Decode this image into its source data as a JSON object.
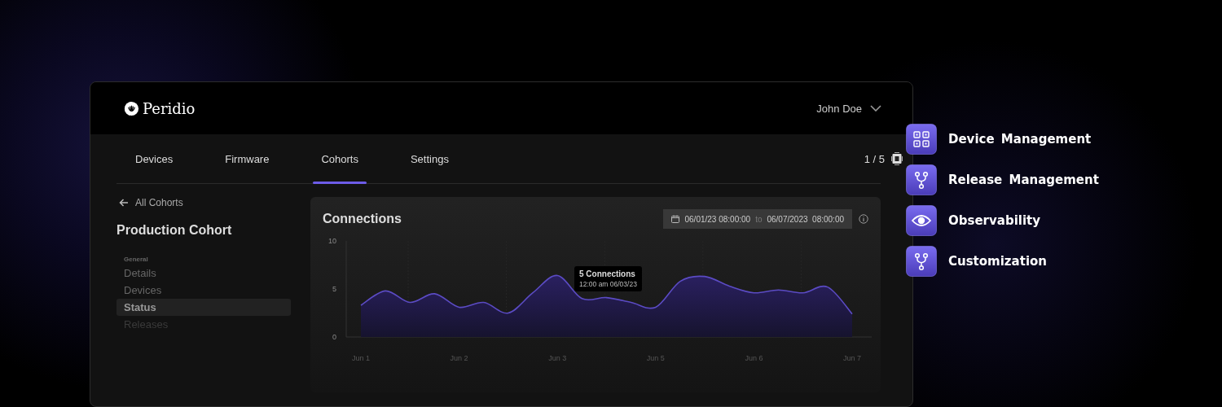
{
  "app": {
    "brand": {
      "name": "Peridio"
    },
    "user": {
      "name": "John Doe"
    },
    "tabs": [
      {
        "label": "Devices",
        "selected": false
      },
      {
        "label": "Firmware",
        "selected": false
      },
      {
        "label": "Cohorts",
        "selected": true
      },
      {
        "label": "Settings",
        "selected": false
      }
    ],
    "pager": {
      "text": "1 / 5"
    },
    "back_link": {
      "label": "All Cohorts"
    },
    "page_title": "Production Cohort",
    "sidebar": {
      "section": "General",
      "items": [
        {
          "label": "Details",
          "selected": false,
          "disabled": false
        },
        {
          "label": "Devices",
          "selected": false,
          "disabled": false
        },
        {
          "label": "Status",
          "selected": true,
          "disabled": false
        },
        {
          "label": "Releases",
          "selected": false,
          "disabled": true
        }
      ]
    },
    "chart_card": {
      "title": "Connections",
      "date_range": {
        "start": "06/01/23 08:00:00",
        "separator": "to",
        "end": "06/07/2023  08:00:00"
      },
      "tooltip": {
        "title": "5 Connections",
        "subtitle": "12:00 am 06/03/23"
      },
      "chart_data": {
        "type": "area",
        "categories": [
          "Jun 1",
          null,
          null,
          null,
          "Jun 2",
          null,
          null,
          null,
          "Jun 3",
          null,
          null,
          null,
          "Jun 5",
          null,
          null,
          null,
          "Jun 6",
          null,
          null,
          null,
          "Jun 7"
        ],
        "series": [
          {
            "color": "#5b4bc4",
            "values": [
              3.3,
              4.8,
              3.6,
              4.5,
              3.1,
              3.6,
              2.5,
              4.6,
              6.4,
              4.0,
              4.1,
              3.6,
              3.1,
              5.8,
              6.3,
              5.3,
              4.6,
              4.9,
              4.6,
              5.2,
              2.4
            ]
          }
        ],
        "ylim": [
          0,
          10
        ],
        "grid": true,
        "yticks": [
          0,
          5,
          10
        ]
      }
    }
  },
  "features": [
    {
      "label": "Device Management",
      "kind": "grid"
    },
    {
      "label": "Release Management",
      "kind": "branch"
    },
    {
      "label": "Observability",
      "kind": "eye"
    },
    {
      "label": "Customization",
      "kind": "branch"
    }
  ]
}
